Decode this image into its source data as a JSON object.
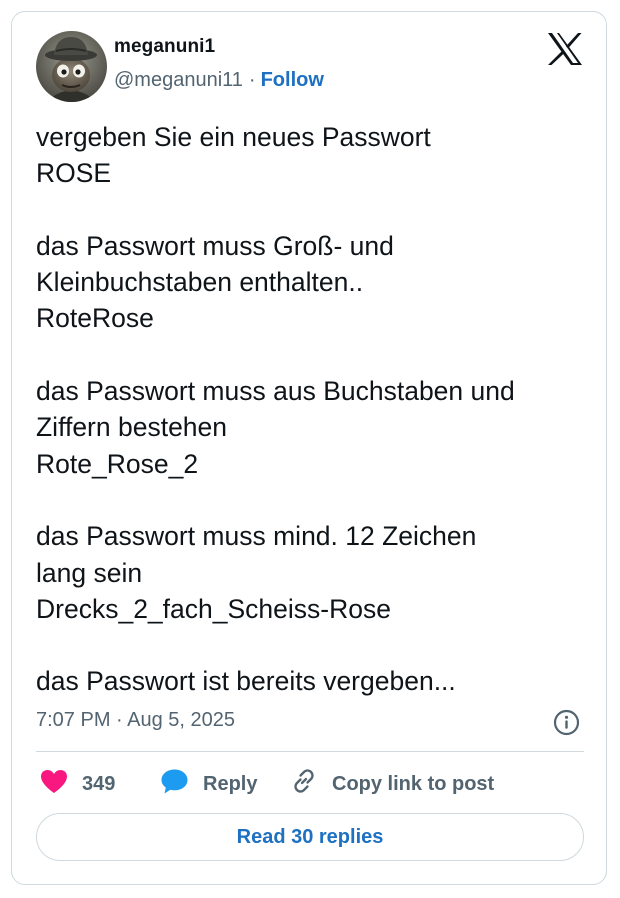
{
  "author": {
    "display_name": "meganuni1",
    "handle": "@meganuni11",
    "separator": "·",
    "follow_label": "Follow"
  },
  "tweet": {
    "paragraphs": [
      [
        "vergeben Sie ein neues Passwort",
        "ROSE"
      ],
      [
        "das Passwort muss Groß- und",
        "Kleinbuchstaben enthalten..",
        "RoteRose"
      ],
      [
        "das Passwort muss aus Buchstaben und",
        "Ziffern bestehen",
        "Rote_Rose_2"
      ],
      [
        "das Passwort muss mind. 12 Zeichen",
        "lang sein",
        "Drecks_2_fach_Scheiss-Rose"
      ],
      [
        "das Passwort ist bereits vergeben..."
      ]
    ],
    "timestamp": "7:07 PM · Aug 5, 2025"
  },
  "actions": {
    "like_count": "349",
    "reply_label": "Reply",
    "copy_link_label": "Copy link to post"
  },
  "read_replies_label": "Read 30 replies",
  "icons": {
    "logo": "x-logo-icon",
    "info": "info-icon",
    "like": "heart-icon",
    "reply": "speech-bubble-icon",
    "copy": "link-icon"
  },
  "colors": {
    "link": "#1d70c2",
    "heart": "#f91880",
    "reply_bubble": "#1d9bf0",
    "secondary_text": "#536471",
    "border": "#cfd9de"
  }
}
